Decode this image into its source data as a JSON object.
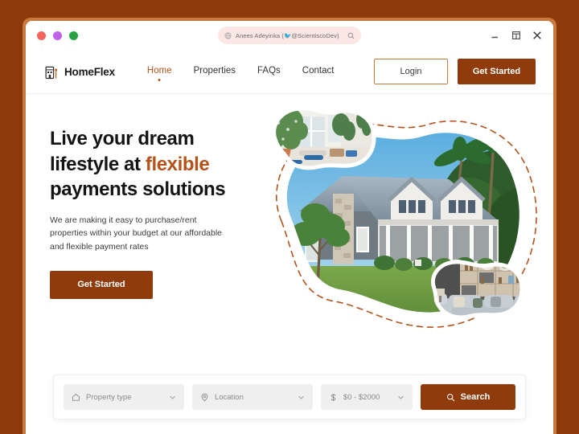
{
  "browser": {
    "traffic_lights": [
      "red",
      "purple",
      "green"
    ],
    "address": {
      "prefix": "Anees Adeyinka (",
      "handle": "@ScientiscoDev",
      "suffix": ")",
      "globe_icon": "globe-icon",
      "search_icon": "search-icon"
    },
    "controls": {
      "minimize": "minimize-icon",
      "maximize": "maximize-icon",
      "close": "close-icon"
    }
  },
  "nav": {
    "brand": "HomeFlex",
    "brand_icon": "building-icon",
    "links": [
      {
        "label": "Home",
        "active": true
      },
      {
        "label": "Properties",
        "active": false
      },
      {
        "label": "FAQs",
        "active": false
      },
      {
        "label": "Contact",
        "active": false
      }
    ],
    "login_label": "Login",
    "get_started_label": "Get Started"
  },
  "hero": {
    "headline_line1": "Live your dream",
    "headline_line2_pre": "lifestyle at ",
    "headline_line2_accent": "flexible",
    "headline_line3": "payments solutions",
    "subtext": "We are making it easy to purchase/rent properties within your budget at our affordable and flexible payment rates",
    "cta_label": "Get Started",
    "images": {
      "main": "house-exterior-photo",
      "top_left": "interior-plants-photo",
      "bottom_right": "living-room-photo",
      "outline": "dashed-blob-outline"
    }
  },
  "search": {
    "property_type": {
      "label": "Property type",
      "icon": "home-icon",
      "chevron": "chevron-down-icon"
    },
    "location": {
      "label": "Location",
      "icon": "map-pin-icon",
      "chevron": "chevron-down-icon"
    },
    "price": {
      "label": "$0 - $2000",
      "icon": "dollar-icon",
      "chevron": "chevron-down-icon"
    },
    "search_button": {
      "label": "Search",
      "icon": "search-icon"
    }
  },
  "colors": {
    "page_background": "#8C3A0B",
    "frame": "#C8793F",
    "primary": "#8F3B0B",
    "accent": "#B4521A",
    "pill_background": "#FBE7E4",
    "filter_background": "#EFEFEF"
  }
}
